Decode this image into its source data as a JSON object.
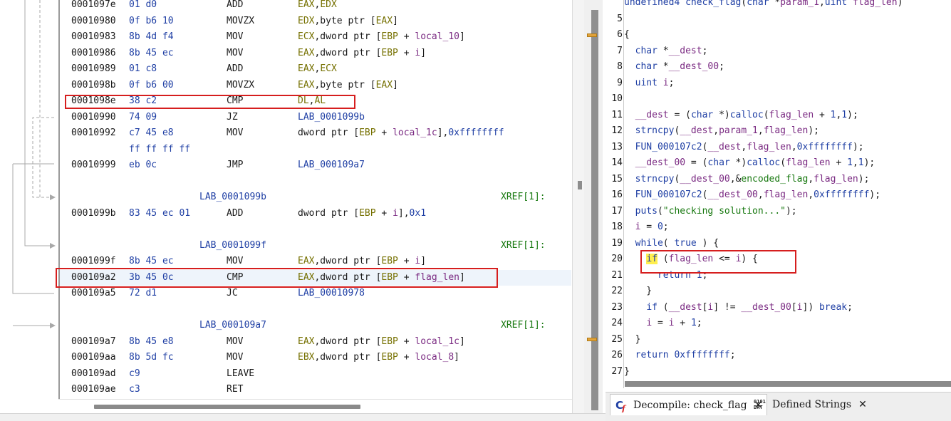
{
  "listing": {
    "rows": [
      {
        "addr": "0001097e",
        "bytes": "01 d0",
        "mnem": "ADD",
        "ops": [
          {
            "t": "EAX",
            "c": "reg"
          },
          {
            "t": ",",
            "c": "txt"
          },
          {
            "t": "EDX",
            "c": "reg"
          }
        ]
      },
      {
        "addr": "00010980",
        "bytes": "0f b6 10",
        "mnem": "MOVZX",
        "ops": [
          {
            "t": "EDX",
            "c": "reg"
          },
          {
            "t": ",byte ptr [",
            "c": "txt"
          },
          {
            "t": "EAX",
            "c": "reg"
          },
          {
            "t": "]",
            "c": "txt"
          }
        ]
      },
      {
        "addr": "00010983",
        "bytes": "8b 4d f4",
        "mnem": "MOV",
        "ops": [
          {
            "t": "ECX",
            "c": "reg"
          },
          {
            "t": ",dword ptr [",
            "c": "txt"
          },
          {
            "t": "EBP",
            "c": "reg"
          },
          {
            "t": " + ",
            "c": "txt"
          },
          {
            "t": "local_10",
            "c": "sym"
          },
          {
            "t": "]",
            "c": "txt"
          }
        ]
      },
      {
        "addr": "00010986",
        "bytes": "8b 45 ec",
        "mnem": "MOV",
        "ops": [
          {
            "t": "EAX",
            "c": "reg"
          },
          {
            "t": ",dword ptr [",
            "c": "txt"
          },
          {
            "t": "EBP",
            "c": "reg"
          },
          {
            "t": " + ",
            "c": "txt"
          },
          {
            "t": "i",
            "c": "sym"
          },
          {
            "t": "]",
            "c": "txt"
          }
        ]
      },
      {
        "addr": "00010989",
        "bytes": "01 c8",
        "mnem": "ADD",
        "ops": [
          {
            "t": "EAX",
            "c": "reg"
          },
          {
            "t": ",",
            "c": "txt"
          },
          {
            "t": "ECX",
            "c": "reg"
          }
        ]
      },
      {
        "addr": "0001098b",
        "bytes": "0f b6 00",
        "mnem": "MOVZX",
        "ops": [
          {
            "t": "EAX",
            "c": "reg"
          },
          {
            "t": ",byte ptr [",
            "c": "txt"
          },
          {
            "t": "EAX",
            "c": "reg"
          },
          {
            "t": "]",
            "c": "txt"
          }
        ]
      },
      {
        "addr": "0001098e",
        "bytes": "38 c2",
        "mnem": "CMP",
        "ops": [
          {
            "t": "DL",
            "c": "reg"
          },
          {
            "t": ",",
            "c": "txt"
          },
          {
            "t": "AL",
            "c": "reg"
          }
        ]
      },
      {
        "addr": "00010990",
        "bytes": "74 09",
        "mnem": "JZ",
        "ops": [
          {
            "t": "LAB_0001099b",
            "c": "lbl"
          }
        ]
      },
      {
        "addr": "00010992",
        "bytes": "c7 45 e8",
        "mnem": "MOV",
        "ops": [
          {
            "t": "dword ptr [",
            "c": "txt"
          },
          {
            "t": "EBP",
            "c": "reg"
          },
          {
            "t": " + ",
            "c": "txt"
          },
          {
            "t": "local_1c",
            "c": "sym"
          },
          {
            "t": "],",
            "c": "txt"
          },
          {
            "t": "0xffffffff",
            "c": "num"
          }
        ]
      },
      {
        "addr": "",
        "bytes": "ff ff ff ff",
        "mnem": "",
        "ops": []
      },
      {
        "addr": "00010999",
        "bytes": "eb 0c",
        "mnem": "JMP",
        "ops": [
          {
            "t": "LAB_000109a7",
            "c": "lbl"
          }
        ]
      },
      {
        "blank": true
      },
      {
        "label": "LAB_0001099b",
        "xref": "XREF[1]:"
      },
      {
        "addr": "0001099b",
        "bytes": "83 45 ec 01",
        "mnem": "ADD",
        "ops": [
          {
            "t": "dword ptr [",
            "c": "txt"
          },
          {
            "t": "EBP",
            "c": "reg"
          },
          {
            "t": " + ",
            "c": "txt"
          },
          {
            "t": "i",
            "c": "sym"
          },
          {
            "t": "],",
            "c": "txt"
          },
          {
            "t": "0x1",
            "c": "num"
          }
        ]
      },
      {
        "blank": true
      },
      {
        "label": "LAB_0001099f",
        "xref": "XREF[1]:"
      },
      {
        "addr": "0001099f",
        "bytes": "8b 45 ec",
        "mnem": "MOV",
        "ops": [
          {
            "t": "EAX",
            "c": "reg"
          },
          {
            "t": ",dword ptr [",
            "c": "txt"
          },
          {
            "t": "EBP",
            "c": "reg"
          },
          {
            "t": " + ",
            "c": "txt"
          },
          {
            "t": "i",
            "c": "sym"
          },
          {
            "t": "]",
            "c": "txt"
          }
        ]
      },
      {
        "addr": "000109a2",
        "bytes": "3b 45 0c",
        "mnem": "CMP",
        "ops": [
          {
            "t": "EAX",
            "c": "reg"
          },
          {
            "t": ",dword ptr [",
            "c": "txt"
          },
          {
            "t": "EBP",
            "c": "reg"
          },
          {
            "t": " + ",
            "c": "txt"
          },
          {
            "t": "flag_len",
            "c": "sym"
          },
          {
            "t": "]",
            "c": "txt"
          }
        ]
      },
      {
        "addr": "000109a5",
        "bytes": "72 d1",
        "mnem": "JC",
        "ops": [
          {
            "t": "LAB_00010978",
            "c": "lbl"
          }
        ]
      },
      {
        "blank": true
      },
      {
        "label": "LAB_000109a7",
        "xref": "XREF[1]:"
      },
      {
        "addr": "000109a7",
        "bytes": "8b 45 e8",
        "mnem": "MOV",
        "ops": [
          {
            "t": "EAX",
            "c": "reg"
          },
          {
            "t": ",dword ptr [",
            "c": "txt"
          },
          {
            "t": "EBP",
            "c": "reg"
          },
          {
            "t": " + ",
            "c": "txt"
          },
          {
            "t": "local_1c",
            "c": "sym"
          },
          {
            "t": "]",
            "c": "txt"
          }
        ]
      },
      {
        "addr": "000109aa",
        "bytes": "8b 5d fc",
        "mnem": "MOV",
        "ops": [
          {
            "t": "EBX",
            "c": "reg"
          },
          {
            "t": ",dword ptr [",
            "c": "txt"
          },
          {
            "t": "EBP",
            "c": "reg"
          },
          {
            "t": " + ",
            "c": "txt"
          },
          {
            "t": "local_8",
            "c": "sym"
          },
          {
            "t": "]",
            "c": "txt"
          }
        ]
      },
      {
        "addr": "000109ad",
        "bytes": "c9",
        "mnem": "LEAVE",
        "ops": []
      },
      {
        "addr": "000109ae",
        "bytes": "c3",
        "mnem": "RET",
        "ops": []
      }
    ]
  },
  "decompiler": {
    "lines": [
      {
        "n": "",
        "code": [
          {
            "t": "undefined4 ",
            "c": "k"
          },
          {
            "t": "check_flag",
            "c": "f"
          },
          {
            "t": "(",
            "c": "p"
          },
          {
            "t": "char",
            "c": "k"
          },
          {
            "t": " *",
            "c": "p"
          },
          {
            "t": "param_1",
            "c": "v"
          },
          {
            "t": ",",
            "c": "p"
          },
          {
            "t": "uint",
            "c": "k"
          },
          {
            "t": " ",
            "c": "p"
          },
          {
            "t": "flag_len",
            "c": "v"
          },
          {
            "t": ")",
            "c": "p"
          }
        ]
      },
      {
        "n": "5",
        "code": []
      },
      {
        "n": "6",
        "code": [
          {
            "t": "{",
            "c": "p"
          }
        ]
      },
      {
        "n": "7",
        "code": [
          {
            "t": "  ",
            "c": "p"
          },
          {
            "t": "char",
            "c": "k"
          },
          {
            "t": " *",
            "c": "p"
          },
          {
            "t": "__dest",
            "c": "v"
          },
          {
            "t": ";",
            "c": "p"
          }
        ]
      },
      {
        "n": "8",
        "code": [
          {
            "t": "  ",
            "c": "p"
          },
          {
            "t": "char",
            "c": "k"
          },
          {
            "t": " *",
            "c": "p"
          },
          {
            "t": "__dest_00",
            "c": "v"
          },
          {
            "t": ";",
            "c": "p"
          }
        ]
      },
      {
        "n": "9",
        "code": [
          {
            "t": "  ",
            "c": "p"
          },
          {
            "t": "uint",
            "c": "k"
          },
          {
            "t": " ",
            "c": "p"
          },
          {
            "t": "i",
            "c": "v"
          },
          {
            "t": ";",
            "c": "p"
          }
        ]
      },
      {
        "n": "10",
        "code": []
      },
      {
        "n": "11",
        "code": [
          {
            "t": "  ",
            "c": "p"
          },
          {
            "t": "__dest",
            "c": "v"
          },
          {
            "t": " = (",
            "c": "p"
          },
          {
            "t": "char",
            "c": "k"
          },
          {
            "t": " *)",
            "c": "p"
          },
          {
            "t": "calloc",
            "c": "f"
          },
          {
            "t": "(",
            "c": "p"
          },
          {
            "t": "flag_len",
            "c": "v"
          },
          {
            "t": " + ",
            "c": "p"
          },
          {
            "t": "1",
            "c": "k"
          },
          {
            "t": ",",
            "c": "p"
          },
          {
            "t": "1",
            "c": "k"
          },
          {
            "t": ");",
            "c": "p"
          }
        ]
      },
      {
        "n": "12",
        "code": [
          {
            "t": "  ",
            "c": "p"
          },
          {
            "t": "strncpy",
            "c": "f"
          },
          {
            "t": "(",
            "c": "p"
          },
          {
            "t": "__dest",
            "c": "v"
          },
          {
            "t": ",",
            "c": "p"
          },
          {
            "t": "param_1",
            "c": "v"
          },
          {
            "t": ",",
            "c": "p"
          },
          {
            "t": "flag_len",
            "c": "v"
          },
          {
            "t": ");",
            "c": "p"
          }
        ]
      },
      {
        "n": "13",
        "code": [
          {
            "t": "  ",
            "c": "p"
          },
          {
            "t": "FUN_000107c2",
            "c": "f"
          },
          {
            "t": "(",
            "c": "p"
          },
          {
            "t": "__dest",
            "c": "v"
          },
          {
            "t": ",",
            "c": "p"
          },
          {
            "t": "flag_len",
            "c": "v"
          },
          {
            "t": ",",
            "c": "p"
          },
          {
            "t": "0xffffffff",
            "c": "k"
          },
          {
            "t": ");",
            "c": "p"
          }
        ]
      },
      {
        "n": "14",
        "code": [
          {
            "t": "  ",
            "c": "p"
          },
          {
            "t": "__dest_00",
            "c": "v"
          },
          {
            "t": " = (",
            "c": "p"
          },
          {
            "t": "char",
            "c": "k"
          },
          {
            "t": " *)",
            "c": "p"
          },
          {
            "t": "calloc",
            "c": "f"
          },
          {
            "t": "(",
            "c": "p"
          },
          {
            "t": "flag_len",
            "c": "v"
          },
          {
            "t": " + ",
            "c": "p"
          },
          {
            "t": "1",
            "c": "k"
          },
          {
            "t": ",",
            "c": "p"
          },
          {
            "t": "1",
            "c": "k"
          },
          {
            "t": ");",
            "c": "p"
          }
        ]
      },
      {
        "n": "15",
        "code": [
          {
            "t": "  ",
            "c": "p"
          },
          {
            "t": "strncpy",
            "c": "f"
          },
          {
            "t": "(",
            "c": "p"
          },
          {
            "t": "__dest_00",
            "c": "v"
          },
          {
            "t": ",&",
            "c": "p"
          },
          {
            "t": "encoded_flag",
            "c": "g"
          },
          {
            "t": ",",
            "c": "p"
          },
          {
            "t": "flag_len",
            "c": "v"
          },
          {
            "t": ");",
            "c": "p"
          }
        ]
      },
      {
        "n": "16",
        "code": [
          {
            "t": "  ",
            "c": "p"
          },
          {
            "t": "FUN_000107c2",
            "c": "f"
          },
          {
            "t": "(",
            "c": "p"
          },
          {
            "t": "__dest_00",
            "c": "v"
          },
          {
            "t": ",",
            "c": "p"
          },
          {
            "t": "flag_len",
            "c": "v"
          },
          {
            "t": ",",
            "c": "p"
          },
          {
            "t": "0xffffffff",
            "c": "k"
          },
          {
            "t": ");",
            "c": "p"
          }
        ]
      },
      {
        "n": "17",
        "code": [
          {
            "t": "  ",
            "c": "p"
          },
          {
            "t": "puts",
            "c": "f"
          },
          {
            "t": "(",
            "c": "p"
          },
          {
            "t": "\"checking solution...\"",
            "c": "s"
          },
          {
            "t": ");",
            "c": "p"
          }
        ]
      },
      {
        "n": "18",
        "code": [
          {
            "t": "  ",
            "c": "p"
          },
          {
            "t": "i",
            "c": "v"
          },
          {
            "t": " = ",
            "c": "p"
          },
          {
            "t": "0",
            "c": "k"
          },
          {
            "t": ";",
            "c": "p"
          }
        ]
      },
      {
        "n": "19",
        "code": [
          {
            "t": "  ",
            "c": "p"
          },
          {
            "t": "while",
            "c": "k"
          },
          {
            "t": "( ",
            "c": "p"
          },
          {
            "t": "true",
            "c": "k"
          },
          {
            "t": " ) {",
            "c": "p"
          }
        ]
      },
      {
        "n": "20",
        "code": [
          {
            "t": "    ",
            "c": "p"
          },
          {
            "t": "if",
            "c": "k hlif"
          },
          {
            "t": " (",
            "c": "p"
          },
          {
            "t": "flag_len",
            "c": "v"
          },
          {
            "t": " <= ",
            "c": "p"
          },
          {
            "t": "i",
            "c": "v"
          },
          {
            "t": ") {",
            "c": "p"
          }
        ]
      },
      {
        "n": "21",
        "code": [
          {
            "t": "      ",
            "c": "p"
          },
          {
            "t": "return",
            "c": "k"
          },
          {
            "t": " ",
            "c": "p"
          },
          {
            "t": "1",
            "c": "k"
          },
          {
            "t": ";",
            "c": "p"
          }
        ]
      },
      {
        "n": "22",
        "code": [
          {
            "t": "    }",
            "c": "p"
          }
        ]
      },
      {
        "n": "23",
        "code": [
          {
            "t": "    ",
            "c": "p"
          },
          {
            "t": "if",
            "c": "k"
          },
          {
            "t": " (",
            "c": "p"
          },
          {
            "t": "__dest",
            "c": "v"
          },
          {
            "t": "[",
            "c": "p"
          },
          {
            "t": "i",
            "c": "v"
          },
          {
            "t": "] != ",
            "c": "p"
          },
          {
            "t": "__dest_00",
            "c": "v"
          },
          {
            "t": "[",
            "c": "p"
          },
          {
            "t": "i",
            "c": "v"
          },
          {
            "t": "]) ",
            "c": "p"
          },
          {
            "t": "break",
            "c": "k"
          },
          {
            "t": ";",
            "c": "p"
          }
        ]
      },
      {
        "n": "24",
        "code": [
          {
            "t": "    ",
            "c": "p"
          },
          {
            "t": "i",
            "c": "v"
          },
          {
            "t": " = ",
            "c": "p"
          },
          {
            "t": "i",
            "c": "v"
          },
          {
            "t": " + ",
            "c": "p"
          },
          {
            "t": "1",
            "c": "k"
          },
          {
            "t": ";",
            "c": "p"
          }
        ]
      },
      {
        "n": "25",
        "code": [
          {
            "t": "  }",
            "c": "p"
          }
        ]
      },
      {
        "n": "26",
        "code": [
          {
            "t": "  ",
            "c": "p"
          },
          {
            "t": "return",
            "c": "k"
          },
          {
            "t": " ",
            "c": "p"
          },
          {
            "t": "0xffffffff",
            "c": "k"
          },
          {
            "t": ";",
            "c": "p"
          }
        ]
      },
      {
        "n": "27",
        "code": [
          {
            "t": "}",
            "c": "p"
          }
        ]
      }
    ]
  },
  "tabs": [
    {
      "label": "Decompile: check_flag",
      "icon": "decompile-cf-icon",
      "active": true
    },
    {
      "label": "Defined Strings",
      "icon": "binary-dat-icon",
      "active": false
    }
  ],
  "close_glyph": "✕",
  "dat_icon": {
    "top": "0101",
    "bottom": "DAT"
  },
  "colors": {
    "register": "#757000",
    "symbol": "#7a2a82",
    "label": "#1f3fa4",
    "xref": "#17780f",
    "highlight_box": "#d61e1e",
    "if_highlight": "#ffef4f",
    "scroll_marker": "#e2a33a"
  }
}
